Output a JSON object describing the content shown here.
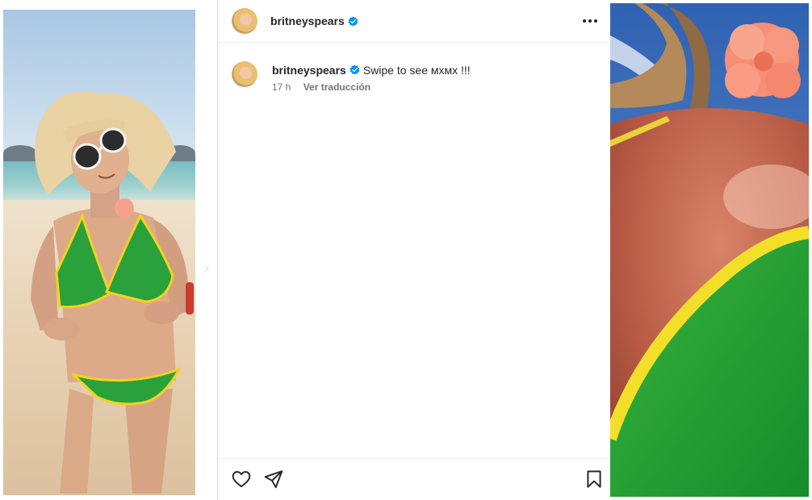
{
  "post": {
    "author": {
      "username": "britneyspears",
      "verified": true
    },
    "caption": {
      "username": "britneyspears",
      "text": "Swipe to see мхмх !!!",
      "time_ago": "17 h",
      "translate_label": "Ver traducción"
    },
    "icons": {
      "more": "more-horizontal-icon",
      "like": "heart-icon",
      "share": "paper-plane-icon",
      "save": "bookmark-icon",
      "verified": "verified-badge-icon"
    }
  },
  "colors": {
    "verified_blue": "#0095f6",
    "text_primary": "#262626",
    "text_secondary": "#737373",
    "bikini_green": "#1f9e3a",
    "bikini_trim": "#f2d21b"
  }
}
